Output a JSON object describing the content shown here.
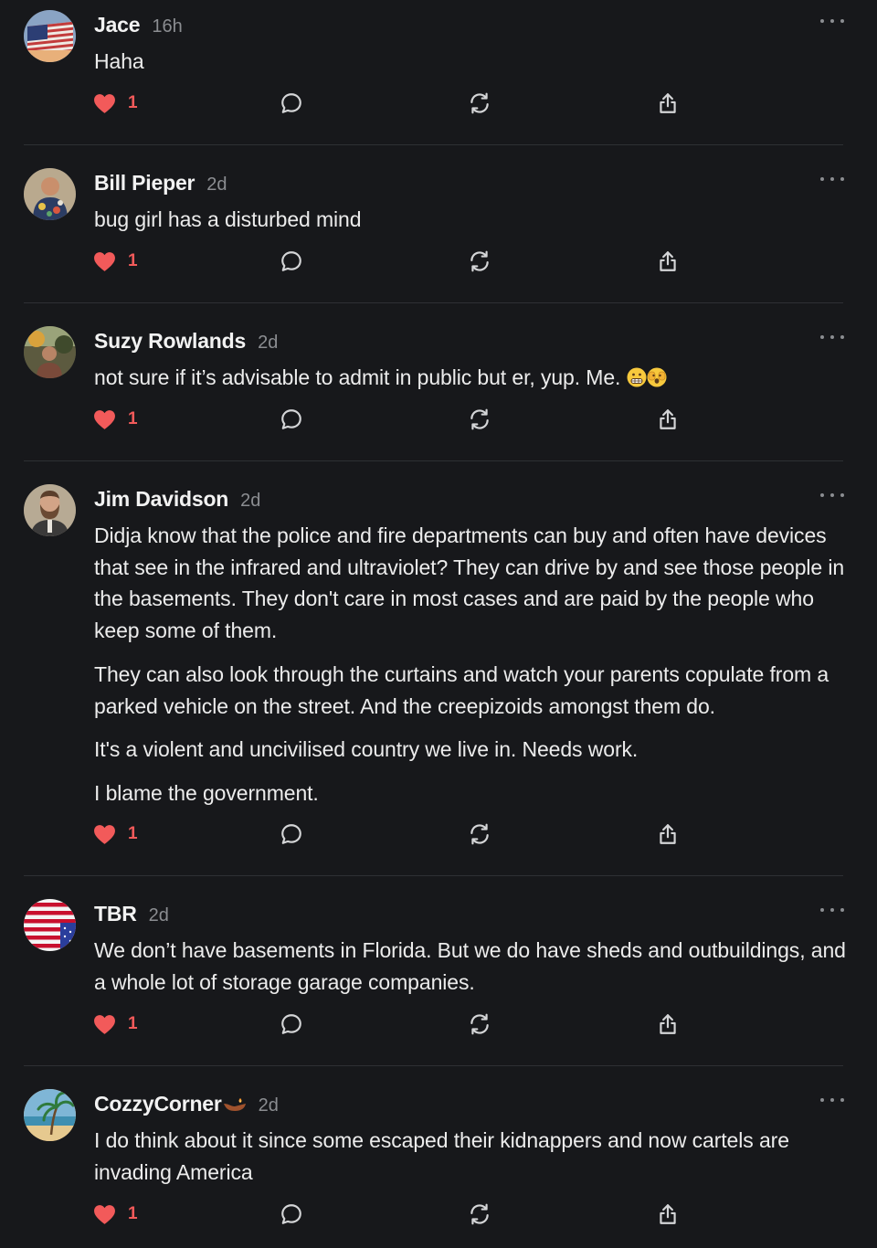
{
  "colors": {
    "background": "#17181b",
    "text": "#ececec",
    "muted": "#8b8d91",
    "like": "#f25a5a",
    "divider": "#2e3034"
  },
  "icons": {
    "like": "heart-icon",
    "reply": "speech-bubble-icon",
    "restack": "restack-arrows-icon",
    "share": "share-icon",
    "more": "ellipsis-icon"
  },
  "comments": [
    {
      "name": "Jace",
      "time": "16h",
      "avatar": "us-flag-avatar",
      "paragraphs": [
        "Haha"
      ],
      "likes": "1"
    },
    {
      "name": "Bill Pieper",
      "time": "2d",
      "avatar": "person-hawaiian-shirt-avatar",
      "paragraphs": [
        "bug girl has a disturbed mind"
      ],
      "likes": "1"
    },
    {
      "name": "Suzy Rowlands",
      "time": "2d",
      "avatar": "outdoor-photo-avatar",
      "paragraphs": [
        "not sure if it’s advisable to admit in public but er, yup. Me."
      ],
      "emojis": [
        "grimacing-face",
        "face-peeking"
      ],
      "likes": "1"
    },
    {
      "name": "Jim Davidson",
      "time": "2d",
      "avatar": "bearded-man-avatar",
      "paragraphs": [
        "Didja know that the police and fire departments can buy and often have devices that see in the infrared and ultraviolet? They can drive by and see those people in the basements. They don't care in most cases and are paid by the people who keep some of them.",
        "They can also look through the curtains and watch your parents copulate from a parked vehicle on the street. And the creepizoids amongst them do.",
        "It's a violent and uncivilised country we live in. Needs work.",
        "I blame the government."
      ],
      "likes": "1"
    },
    {
      "name": "TBR",
      "time": "2d",
      "avatar": "us-flag-circle-avatar",
      "paragraphs": [
        "We don’t have basements in Florida. But we do have sheds and outbuildings, and a whole lot of storage garage companies."
      ],
      "likes": "1"
    },
    {
      "name": "CozzyCorner",
      "time": "2d",
      "name_emoji": "diya-lamp",
      "avatar": "beach-palm-avatar",
      "paragraphs": [
        "I do think about it since some escaped their kidnappers and now cartels are invading America"
      ],
      "likes": "1"
    }
  ]
}
